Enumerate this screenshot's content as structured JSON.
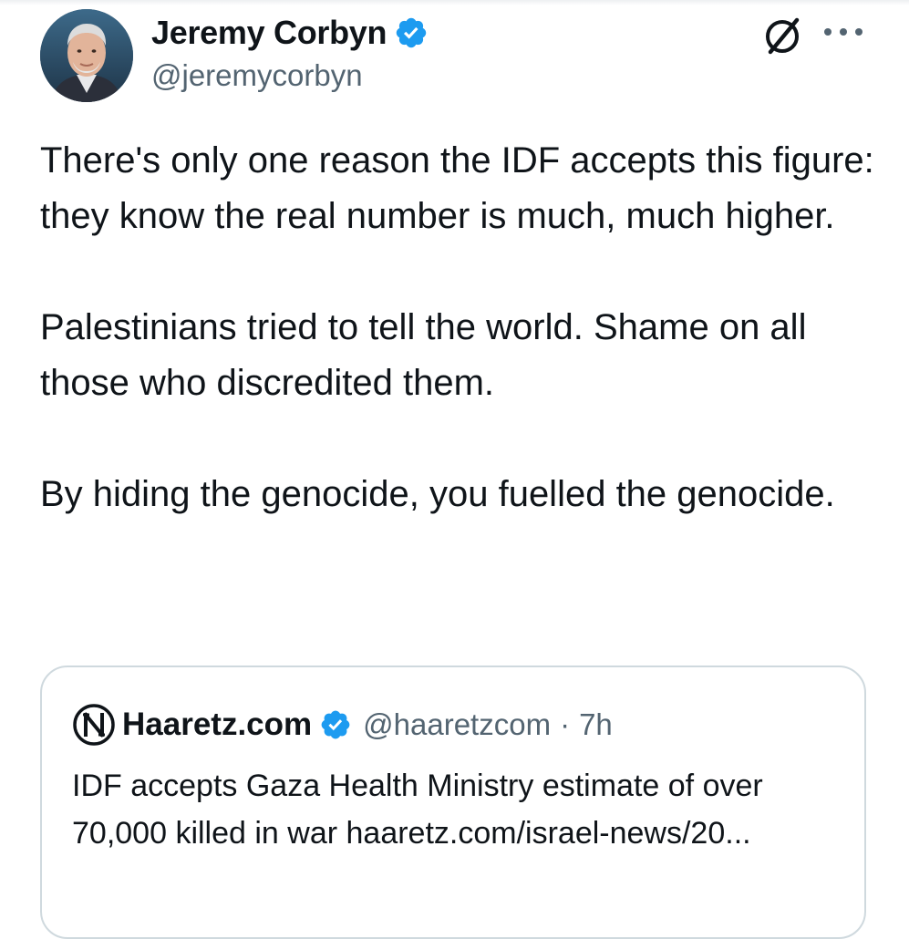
{
  "post": {
    "display_name": "Jeremy Corbyn",
    "handle": "@jeremycorbyn",
    "verified_icon": "verified-badge-icon",
    "avatar_icon": "profile-avatar",
    "actions": {
      "grok_icon": "grok-icon",
      "more_icon": "more-options-icon"
    },
    "paragraphs": [
      "There's only one reason the IDF accepts this figure: they know the real number is much, much higher.",
      "Palestinians tried to tell the world. Shame on all those who discredited them.",
      "By hiding the genocide, you fuelled the genocide."
    ]
  },
  "quote": {
    "logo_icon": "haaretz-logo-icon",
    "display_name": "Haaretz.com",
    "handle": "@haaretzcom",
    "separator": "·",
    "time": "7h",
    "text": "IDF accepts Gaza Health Ministry estimate of over 70,000 killed in war haaretz.com/israel-news/20..."
  },
  "colors": {
    "text": "#0f1419",
    "secondary": "#536471",
    "verified": "#1d9bf0",
    "border": "#cfd9de"
  }
}
